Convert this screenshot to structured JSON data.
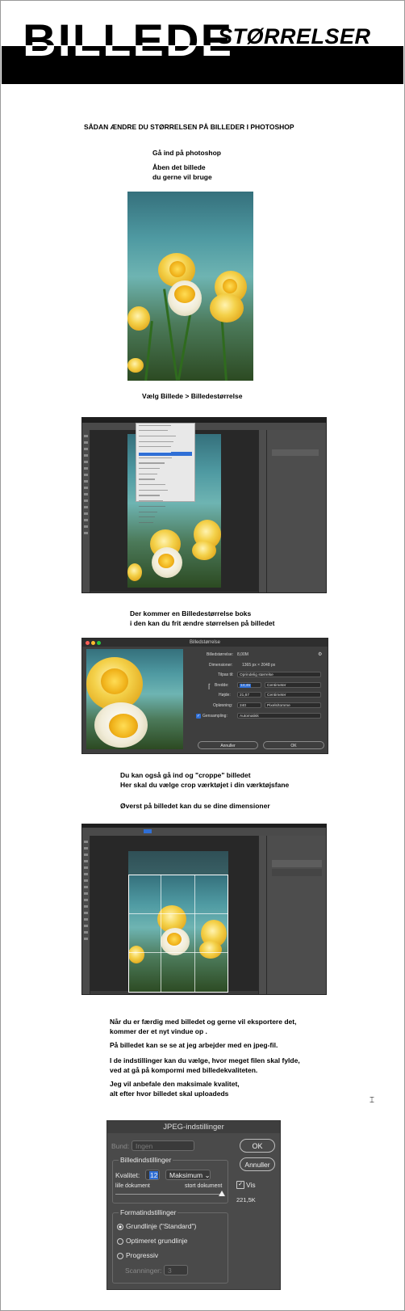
{
  "header": {
    "title_big": "BILLEDE",
    "title_small": "STØRRELSER"
  },
  "intro": {
    "heading": "SÅDAN ÆNDRE DU STØRRELSEN PÅ BILLEDER I PHOTOSHOP",
    "step1": "Gå ind på photoshop",
    "step2": "Åben det billede\ndu gerne vil bruge"
  },
  "step3": "Vælg Billede > Billedestørrelse",
  "step4": "Der kommer en Billedestørrelse boks\ni den kan du frit ændre størrelsen på billedet",
  "image_size_dialog": {
    "title": "Billedstørrelse",
    "size_label": "Billedstørrelse:",
    "size_value": "8,00M",
    "dims_label": "Dimensioner:",
    "dims_value": "1365 px  ×  2048 px",
    "fit_label": "Tilpas til:",
    "fit_value": "Oprindelig størrelse",
    "width_label": "Bredde:",
    "width_value": "14,45",
    "width_unit": "Centimeter",
    "height_label": "Højde:",
    "height_value": "21,67",
    "height_unit": "Centimeter",
    "res_label": "Opløsning:",
    "res_value": "240",
    "res_unit": "Pixels/tomme",
    "resample_label": "Gensampling:",
    "resample_value": "Automatisk",
    "cancel": "Annuller",
    "ok": "OK"
  },
  "step5": "Du kan også gå ind og \"croppe\" billedet\nHer skal du vælge crop værktøjet i din værktøjsfane",
  "step6": "Øverst på billedet kan du se dine dimensioner",
  "export_text": {
    "p1": "Når du er færdig med billedet og gerne vil eksportere det,\nkommer der et nyt vindue op .",
    "p2": "På billedet kan se se at jeg arbejder med en jpeg-fil.",
    "p3": "I de indstillinger kan du vælge, hvor meget filen skal fylde,\nved at gå på kompormi med billedekvaliteten.",
    "p4": "Jeg vil anbefale den maksimale kvalitet,\nalt efter hvor billedet skal uploadeds"
  },
  "jpeg_dialog": {
    "title": "JPEG-indstillinger",
    "matte_label": "Bund:",
    "matte_value": "Ingen",
    "ok": "OK",
    "cancel": "Annuller",
    "image_options": "Billedindstillinger",
    "quality_label": "Kvalitet:",
    "quality_value": "12",
    "quality_preset": "Maksimum",
    "small_file": "lille dokument",
    "large_file": "stort dokument",
    "quality_fraction": 1.0,
    "preview_label": "Vis",
    "file_size": "221,5K",
    "format_options": "Formatindstillinger",
    "opt1": "Grundlinje (\"Standard\")",
    "opt2": "Optimeret grundlinje",
    "opt3": "Progressiv",
    "scans_label": "Scanninger:",
    "scans_value": "3"
  },
  "colors": {
    "header_bar": "#000000",
    "ps_dark": "#3a3a3a",
    "dialog_bg": "#4a4a4a",
    "selection_blue": "#2f6fd6"
  }
}
